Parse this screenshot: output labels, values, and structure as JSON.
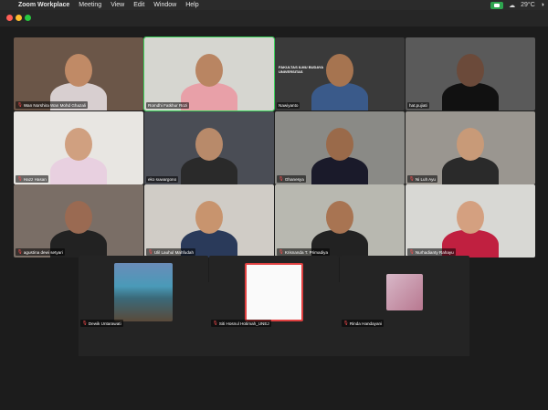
{
  "menubar": {
    "app_name": "Zoom Workplace",
    "items": [
      "Meeting",
      "View",
      "Edit",
      "Window",
      "Help"
    ],
    "temperature": "29°C"
  },
  "participants": [
    {
      "name": "Wan Norshira Wan Mohd Ghazali",
      "muted": true,
      "active": false
    },
    {
      "name": "Romdhi Fatkhur Rozi",
      "muted": false,
      "active": true
    },
    {
      "name": "Nawiyanto",
      "muted": false,
      "active": false
    },
    {
      "name": "hat.pujiati",
      "muted": false,
      "active": false
    },
    {
      "name": "Hazz Hasan",
      "muted": true,
      "active": false
    },
    {
      "name": "eko suwargono",
      "muted": false,
      "active": false
    },
    {
      "name": "Ghanesya",
      "muted": true,
      "active": false
    },
    {
      "name": "Ni Luh Ayu",
      "muted": true,
      "active": false
    },
    {
      "name": "agustina dewi setyari",
      "muted": true,
      "active": false
    },
    {
      "name": "Ulil Lauhul Mahfudah",
      "muted": true,
      "active": false
    },
    {
      "name": "Krisnanda T. Primadiya",
      "muted": true,
      "active": false
    },
    {
      "name": "Nurhadianty Rahayu",
      "muted": true,
      "active": false
    },
    {
      "name": "Dewik Untarawati",
      "muted": true,
      "active": false
    },
    {
      "name": "Siti Hosnul Hotimah_UNEJ",
      "muted": true,
      "active": false
    },
    {
      "name": "Rinda Handayani",
      "muted": true,
      "active": false
    }
  ],
  "banner_text": "FAKULTAS ILMU BUDAYA UNIVERSITAS",
  "colors": {
    "active_border": "#3ad25a",
    "muted_icon": "#ff4d4f",
    "zoom_green": "#2ea44f"
  }
}
